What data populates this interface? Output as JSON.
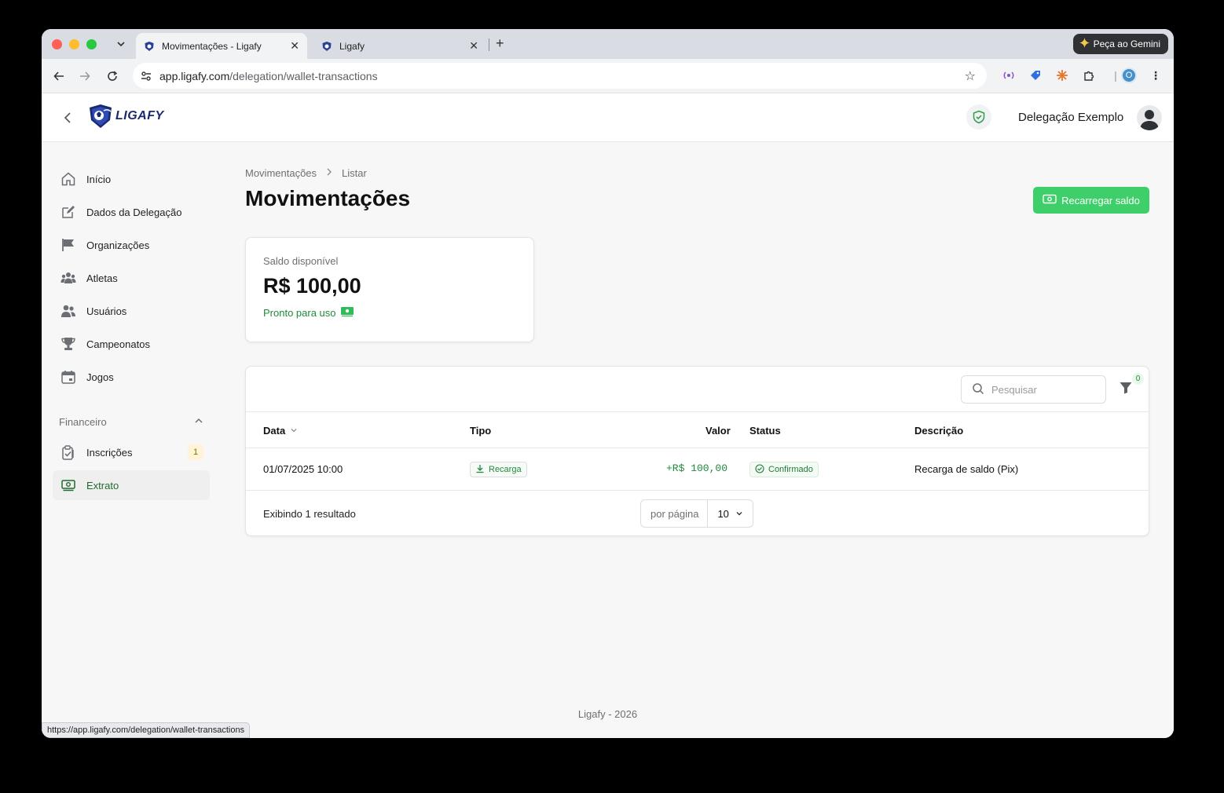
{
  "browser": {
    "tabs": [
      {
        "title": "Movimentações - Ligafy",
        "active": true
      },
      {
        "title": "Ligafy",
        "active": false
      }
    ],
    "gemini_label": "Peça ao Gemini",
    "url_domain": "app.ligafy.com",
    "url_path": "/delegation/wallet-transactions",
    "status_url": "https://app.ligafy.com/delegation/wallet-transactions",
    "profile_initial": "O"
  },
  "header": {
    "logo_text": "LIGAFY",
    "user_name": "Delegação Exemplo"
  },
  "sidebar": {
    "items": [
      {
        "label": "Início",
        "icon": "home-icon"
      },
      {
        "label": "Dados da Delegação",
        "icon": "edit-icon"
      },
      {
        "label": "Organizações",
        "icon": "flag-icon"
      },
      {
        "label": "Atletas",
        "icon": "group-icon"
      },
      {
        "label": "Usuários",
        "icon": "users-icon"
      },
      {
        "label": "Campeonatos",
        "icon": "trophy-icon"
      },
      {
        "label": "Jogos",
        "icon": "calendar-icon"
      }
    ],
    "section_label": "Financeiro",
    "finance_items": [
      {
        "label": "Inscrições",
        "icon": "clipboard-icon",
        "badge": "1"
      },
      {
        "label": "Extrato",
        "icon": "money-icon",
        "active": true
      }
    ]
  },
  "main": {
    "breadcrumb": [
      "Movimentações",
      "Listar"
    ],
    "title": "Movimentações",
    "recharge_button": "Recarregar saldo",
    "balance": {
      "label": "Saldo disponível",
      "amount": "R$ 100,00",
      "status": "Pronto para uso"
    },
    "table": {
      "search_placeholder": "Pesquisar",
      "filter_count": "0",
      "columns": [
        "Data",
        "Tipo",
        "Valor",
        "Status",
        "Descrição"
      ],
      "rows": [
        {
          "data": "01/07/2025 10:00",
          "tipo": "Recarga",
          "valor": "+R$ 100,00",
          "status": "Confirmado",
          "descricao": "Recarga de saldo (Pix)"
        }
      ],
      "results_text": "Exibindo 1 resultado",
      "per_page_label": "por página",
      "per_page_value": "10"
    },
    "footer": "Ligafy - 2026"
  },
  "colors": {
    "accent_green": "#3ecf6b",
    "text_green": "#1f8a3b",
    "brand_navy": "#1a2a6c"
  }
}
